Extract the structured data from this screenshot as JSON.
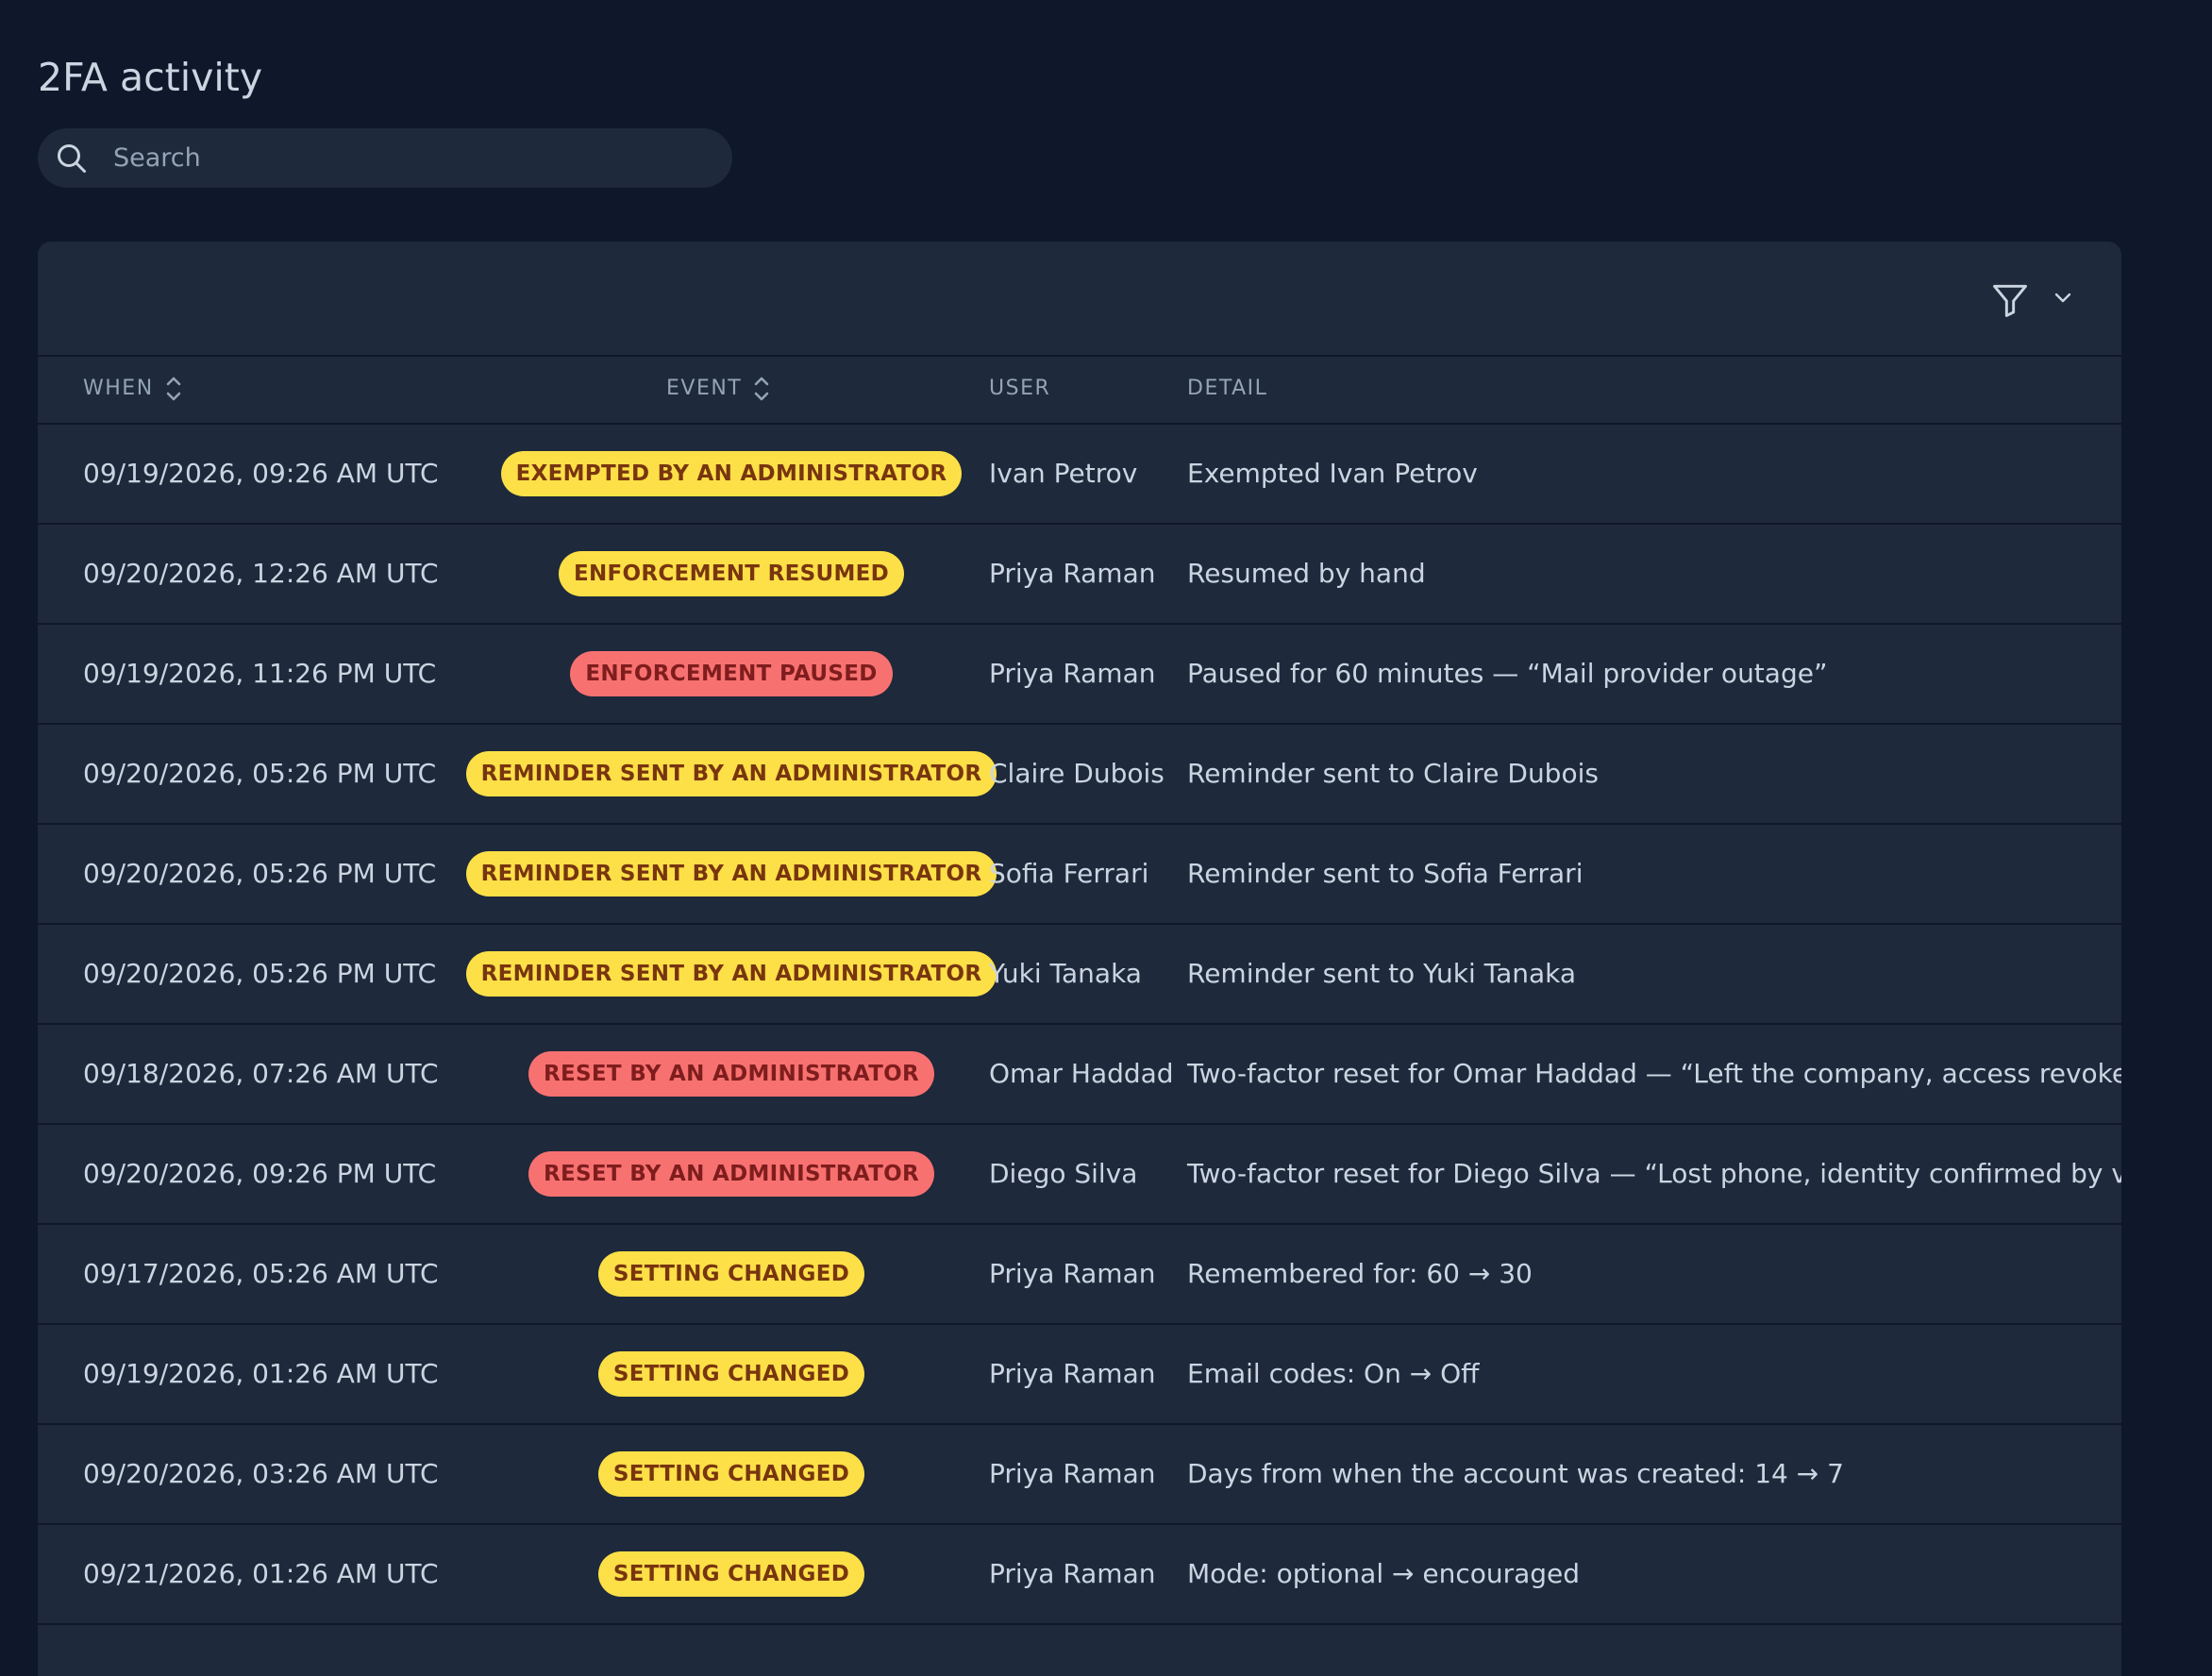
{
  "page": {
    "title": "2FA activity"
  },
  "search": {
    "placeholder": "Search"
  },
  "table": {
    "columns": {
      "when": "WHEN",
      "event": "EVENT",
      "user": "USER",
      "detail": "DETAIL"
    },
    "rows": [
      {
        "when": "09/19/2026, 09:26 AM UTC",
        "event": "EXEMPTED BY AN ADMINISTRATOR",
        "severity": "warn",
        "user": "Ivan Petrov",
        "detail": "Exempted Ivan Petrov"
      },
      {
        "when": "09/20/2026, 12:26 AM UTC",
        "event": "ENFORCEMENT RESUMED",
        "severity": "warn",
        "user": "Priya Raman",
        "detail": "Resumed by hand"
      },
      {
        "when": "09/19/2026, 11:26 PM UTC",
        "event": "ENFORCEMENT PAUSED",
        "severity": "danger",
        "user": "Priya Raman",
        "detail": "Paused for 60 minutes — “Mail provider outage”"
      },
      {
        "when": "09/20/2026, 05:26 PM UTC",
        "event": "REMINDER SENT BY AN ADMINISTRATOR",
        "severity": "warn",
        "user": "Claire Dubois",
        "detail": "Reminder sent to Claire Dubois"
      },
      {
        "when": "09/20/2026, 05:26 PM UTC",
        "event": "REMINDER SENT BY AN ADMINISTRATOR",
        "severity": "warn",
        "user": "Sofia Ferrari",
        "detail": "Reminder sent to Sofia Ferrari"
      },
      {
        "when": "09/20/2026, 05:26 PM UTC",
        "event": "REMINDER SENT BY AN ADMINISTRATOR",
        "severity": "warn",
        "user": "Yuki Tanaka",
        "detail": "Reminder sent to Yuki Tanaka"
      },
      {
        "when": "09/18/2026, 07:26 AM UTC",
        "event": "RESET BY AN ADMINISTRATOR",
        "severity": "danger",
        "user": "Omar Haddad",
        "detail": "Two-factor reset for Omar Haddad — “Left the company, access revoked”"
      },
      {
        "when": "09/20/2026, 09:26 PM UTC",
        "event": "RESET BY AN ADMINISTRATOR",
        "severity": "danger",
        "user": "Diego Silva",
        "detail": "Two-factor reset for Diego Silva — “Lost phone, identity confirmed by video ca"
      },
      {
        "when": "09/17/2026, 05:26 AM UTC",
        "event": "SETTING CHANGED",
        "severity": "warn",
        "user": "Priya Raman",
        "detail": "Remembered for: 60 → 30"
      },
      {
        "when": "09/19/2026, 01:26 AM UTC",
        "event": "SETTING CHANGED",
        "severity": "warn",
        "user": "Priya Raman",
        "detail": "Email codes: On → Off"
      },
      {
        "when": "09/20/2026, 03:26 AM UTC",
        "event": "SETTING CHANGED",
        "severity": "warn",
        "user": "Priya Raman",
        "detail": "Days from when the account was created: 14 → 7"
      },
      {
        "when": "09/21/2026, 01:26 AM UTC",
        "event": "SETTING CHANGED",
        "severity": "warn",
        "user": "Priya Raman",
        "detail": "Mode: optional → encouraged"
      }
    ]
  },
  "icons": {
    "search": "search-icon",
    "filter": "filter-icon",
    "chevron": "chevron-down-icon",
    "sort": "sort-icon"
  },
  "colors": {
    "background": "#0f172a",
    "panel": "#1e293b",
    "badge_warn": "#fde047",
    "badge_danger": "#f87171"
  }
}
